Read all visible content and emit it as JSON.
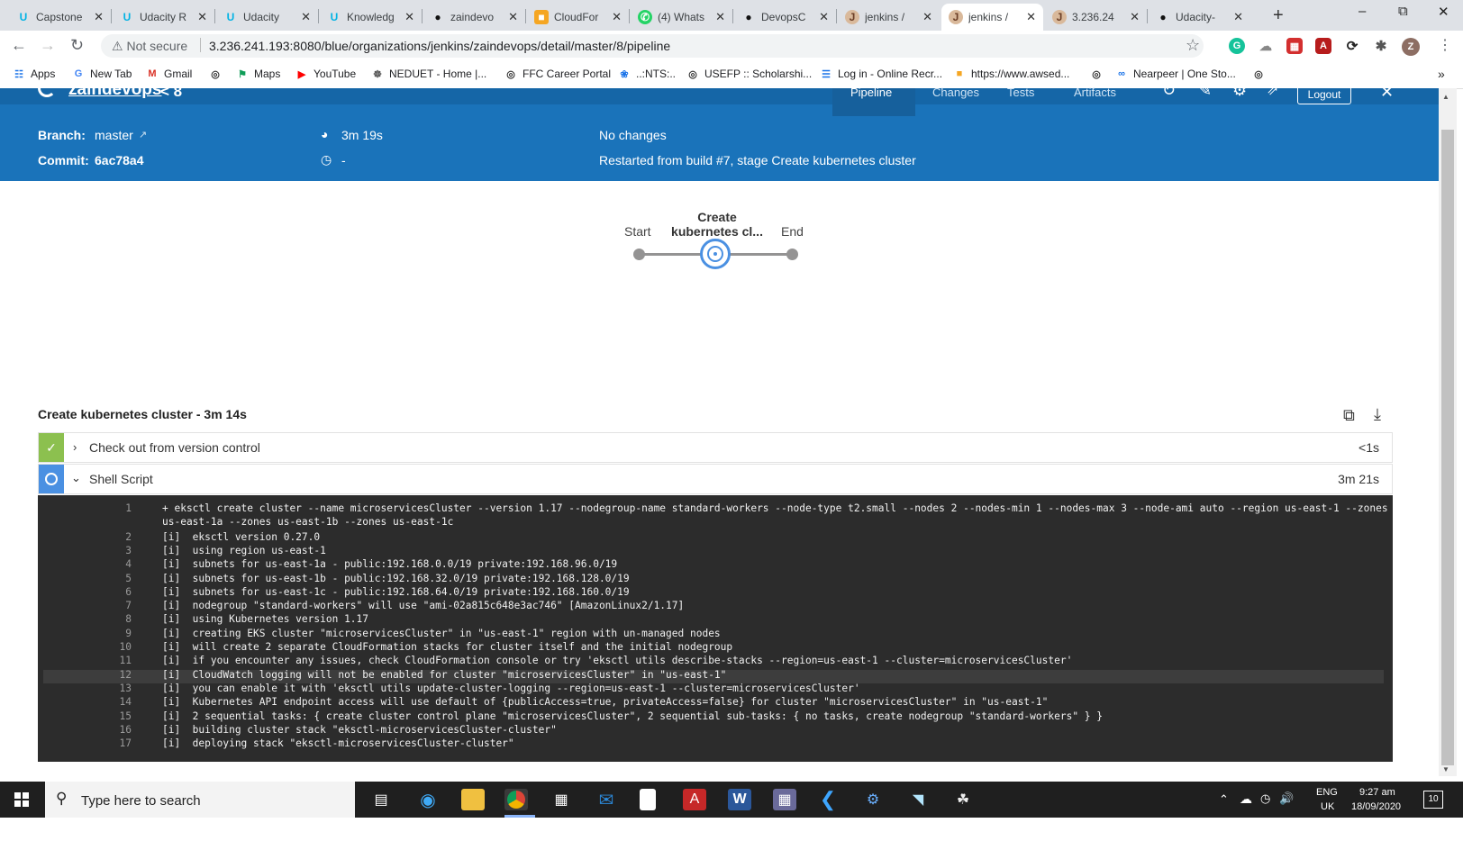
{
  "browser": {
    "tabs": [
      {
        "title": "Capstone",
        "icon": "udacity-icon"
      },
      {
        "title": "Udacity R",
        "icon": "udacity-icon"
      },
      {
        "title": "Udacity",
        "icon": "udacity-icon"
      },
      {
        "title": "Knowledg",
        "icon": "udacity-icon"
      },
      {
        "title": "zaindevo",
        "icon": "github-icon"
      },
      {
        "title": "CloudFor",
        "icon": "aws-icon"
      },
      {
        "title": "(4) Whats",
        "icon": "whatsapp-icon"
      },
      {
        "title": "DevopsC",
        "icon": "github-icon"
      },
      {
        "title": "jenkins /",
        "icon": "jenkins-icon"
      },
      {
        "title": "jenkins /",
        "icon": "jenkins-icon"
      },
      {
        "title": "3.236.24",
        "icon": "jenkins-icon"
      },
      {
        "title": "Udacity-",
        "icon": "github-icon"
      }
    ],
    "new_tab": "+",
    "not_secure": "Not secure",
    "url": "3.236.241.193:8080/blue/organizations/jenkins/zaindevops/detail/master/8/pipeline",
    "profile_initial": "Z",
    "bookmarks": [
      "Apps",
      "New Tab",
      "Gmail",
      "",
      "Maps",
      "YouTube",
      "NEDUET - Home |...",
      "FFC Career Portal",
      "..:NTS:..",
      "USEFP :: Scholarshi...",
      "Log in - Online Recr...",
      "https://www.awsed...",
      "",
      "Nearpeer | One Sto...",
      ""
    ],
    "bookmarks_more": "»"
  },
  "header": {
    "title": "zaindevops",
    "build_sep": "< 8",
    "tabs": [
      "Pipeline",
      "Changes",
      "Tests",
      "Artifacts"
    ],
    "logout": "Logout",
    "branch_label": "Branch:",
    "branch_value": "master",
    "commit_label": "Commit:",
    "commit_value": "6ac78a4",
    "duration": "3m 19s",
    "time_ago": "-",
    "changes": "No changes",
    "cause": "Restarted from build #7, stage Create kubernetes cluster"
  },
  "graph": {
    "start": "Start",
    "stage_line1": "Create",
    "stage_line2": "kubernetes cl...",
    "end": "End"
  },
  "log": {
    "title": "Create kubernetes cluster - 3m 14s",
    "steps": [
      {
        "label": "Check out from version control",
        "duration": "<1s",
        "status": "success"
      },
      {
        "label": "Shell Script",
        "duration": "3m 21s",
        "status": "running"
      }
    ],
    "lines": [
      {
        "n": "1",
        "t": "+ eksctl create cluster --name microservicesCluster --version 1.17 --nodegroup-name standard-workers --node-type t2.small --nodes 2 --nodes-min 1 --nodes-max 3 --node-ami auto --region us-east-1 --zones"
      },
      {
        "n": "",
        "t": "us-east-1a --zones us-east-1b --zones us-east-1c"
      },
      {
        "n": "2",
        "t": "[i]  eksctl version 0.27.0"
      },
      {
        "n": "3",
        "t": "[i]  using region us-east-1"
      },
      {
        "n": "4",
        "t": "[i]  subnets for us-east-1a - public:192.168.0.0/19 private:192.168.96.0/19"
      },
      {
        "n": "5",
        "t": "[i]  subnets for us-east-1b - public:192.168.32.0/19 private:192.168.128.0/19"
      },
      {
        "n": "6",
        "t": "[i]  subnets for us-east-1c - public:192.168.64.0/19 private:192.168.160.0/19"
      },
      {
        "n": "7",
        "t": "[i]  nodegroup \"standard-workers\" will use \"ami-02a815c648e3ac746\" [AmazonLinux2/1.17]"
      },
      {
        "n": "8",
        "t": "[i]  using Kubernetes version 1.17"
      },
      {
        "n": "9",
        "t": "[i]  creating EKS cluster \"microservicesCluster\" in \"us-east-1\" region with un-managed nodes"
      },
      {
        "n": "10",
        "t": "[i]  will create 2 separate CloudFormation stacks for cluster itself and the initial nodegroup"
      },
      {
        "n": "11",
        "t": "[i]  if you encounter any issues, check CloudFormation console or try 'eksctl utils describe-stacks --region=us-east-1 --cluster=microservicesCluster'"
      },
      {
        "n": "12",
        "t": "[i]  CloudWatch logging will not be enabled for cluster \"microservicesCluster\" in \"us-east-1\""
      },
      {
        "n": "13",
        "t": "[i]  you can enable it with 'eksctl utils update-cluster-logging --region=us-east-1 --cluster=microservicesCluster'"
      },
      {
        "n": "14",
        "t": "[i]  Kubernetes API endpoint access will use default of {publicAccess=true, privateAccess=false} for cluster \"microservicesCluster\" in \"us-east-1\""
      },
      {
        "n": "15",
        "t": "[i]  2 sequential tasks: { create cluster control plane \"microservicesCluster\", 2 sequential sub-tasks: { no tasks, create nodegroup \"standard-workers\" } }"
      },
      {
        "n": "16",
        "t": "[i]  building cluster stack \"eksctl-microservicesCluster-cluster\""
      },
      {
        "n": "17",
        "t": "[i]  deploying stack \"eksctl-microservicesCluster-cluster\""
      }
    ]
  },
  "taskbar": {
    "search_placeholder": "Type here to search",
    "lang1": "ENG",
    "lang2": "UK",
    "time": "9:27 am",
    "date": "18/09/2020",
    "notif_count": "10"
  },
  "colors": {
    "blue": "#1a73ba",
    "success": "#8cc04f",
    "running": "#4a90e2"
  }
}
